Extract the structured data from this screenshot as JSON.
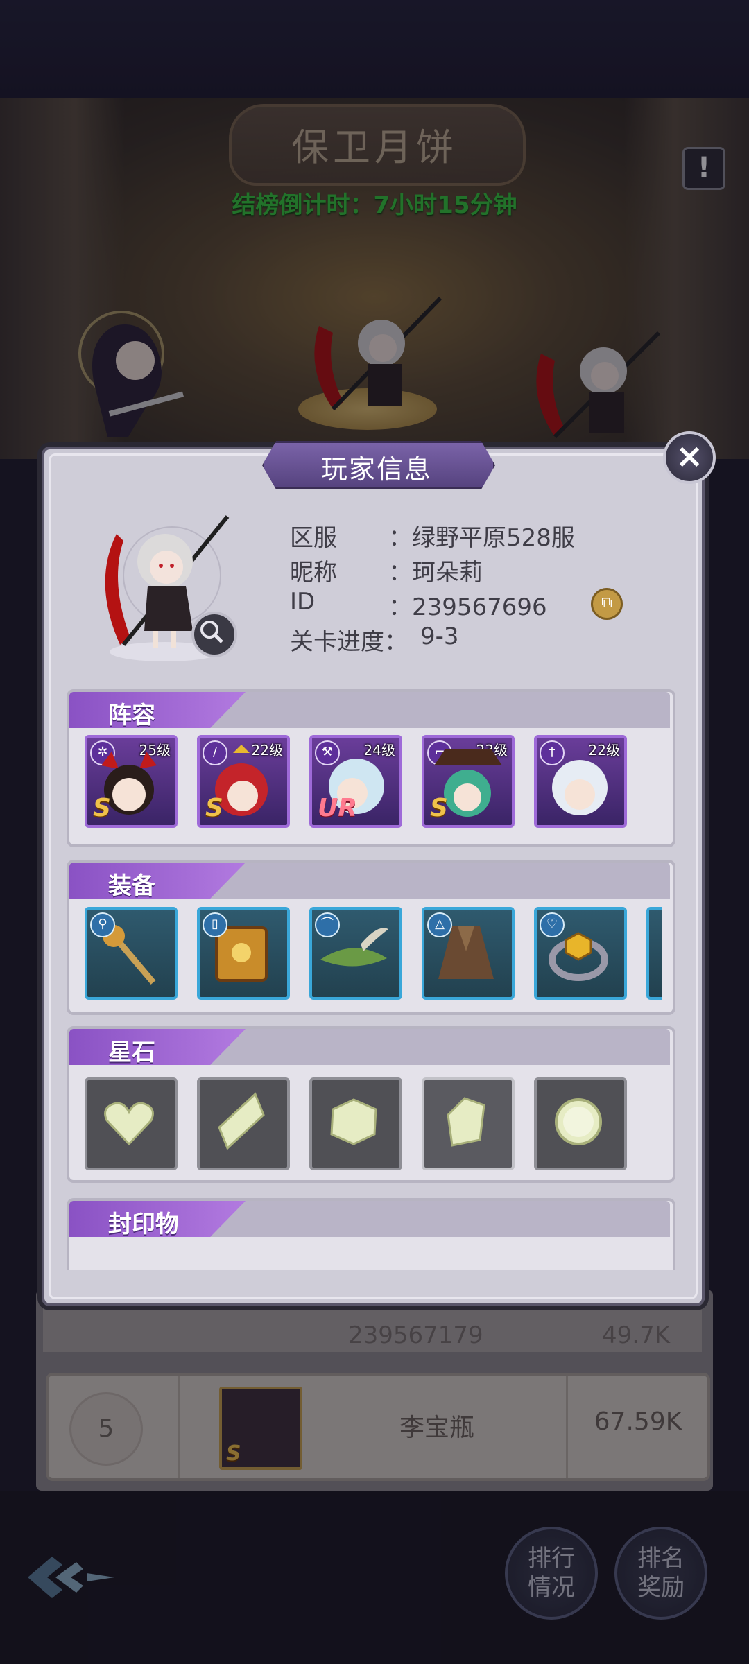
{
  "event": {
    "title": "保卫月饼",
    "countdown": "结榜倒计时：7小时15分钟",
    "info_icon": "exclamation-icon"
  },
  "modal": {
    "title": "玩家信息",
    "player": {
      "server_label": "区服",
      "server_value": "：绿野平原528服",
      "nickname_label": "昵称",
      "nickname_value": "：珂朵莉",
      "id_label": "ID",
      "id_value": "：239567696",
      "stage_label": "关卡进度：",
      "stage_value": "9-3"
    },
    "sections": {
      "lineup": "阵容",
      "equipment": "装备",
      "star_stones": "星石",
      "seals": "封印物"
    },
    "lineup": [
      {
        "level": "25级",
        "grade": "S"
      },
      {
        "level": "22级",
        "grade": "S"
      },
      {
        "level": "24级",
        "grade": "UR"
      },
      {
        "level": "23级",
        "grade": "S"
      },
      {
        "level": "22级",
        "grade": ""
      }
    ],
    "equipment_icons": [
      "bear-scepter-icon",
      "golden-book-icon",
      "feather-hat-icon",
      "cloak-icon",
      "ring-icon"
    ],
    "star_stone_icons": [
      "heart-gem-icon",
      "diamond-gem-icon",
      "hexagon-gem-icon",
      "shard-gem-icon",
      "round-gem-icon"
    ]
  },
  "ranking": {
    "partial_row_id": "239567179",
    "partial_row_score": "49.7K",
    "row": {
      "rank": "5",
      "name": "李宝瓶",
      "score": "67.59K",
      "grade": "S"
    }
  },
  "buttons": {
    "ranking_status": "排行\n情况",
    "ranking_rewards": "排名\n奖励"
  },
  "colors": {
    "accent_purple": "#8a52c4",
    "countdown_green": "#36c93c",
    "equip_border": "#3aa7d9"
  }
}
